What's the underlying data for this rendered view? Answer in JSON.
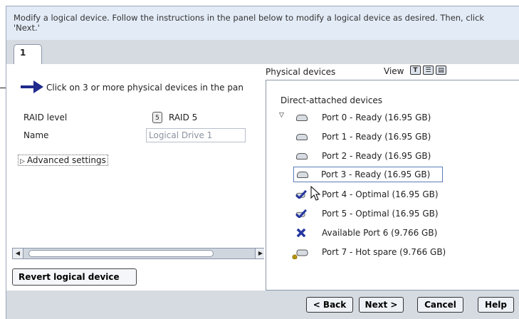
{
  "header": {
    "text": "Modify a logical device.  Follow the instructions in the panel below to modify a logical device as desired. Then, click 'Next.'"
  },
  "tabs": [
    {
      "label": "1"
    }
  ],
  "left": {
    "instruction": "Click on 3 or more physical devices in the pan",
    "raid_label": "RAID level",
    "raid_icon_text": "5",
    "raid_value": "RAID 5",
    "name_label": "Name",
    "name_value": "Logical Drive 1",
    "advanced_label": "Advanced settings",
    "revert_label": "Revert logical device"
  },
  "right": {
    "title": "Physical devices",
    "view_label": "View",
    "view_icons": [
      "T",
      "☰",
      "▤"
    ],
    "tree_title": "Direct-attached devices",
    "devices": [
      {
        "label": "Port 0 - Ready (16.95 GB)",
        "icon": "disk-icon"
      },
      {
        "label": "Port 1 - Ready (16.95 GB)",
        "icon": "disk-icon"
      },
      {
        "label": "Port 2 - Ready (16.95 GB)",
        "icon": "disk-icon"
      },
      {
        "label": "Port 3 - Ready (16.95 GB)",
        "icon": "disk-icon",
        "selected": true
      },
      {
        "label": "Port 4 - Optimal (16.95 GB)",
        "icon": "check-disk-icon"
      },
      {
        "label": "Port 5 - Optimal (16.95 GB)",
        "icon": "check-disk-icon"
      },
      {
        "label": "Available  Port 6 (9.766 GB)",
        "icon": "x-icon"
      },
      {
        "label": "Port 7 - Hot spare (9.766 GB)",
        "icon": "hotspare-disk-icon"
      }
    ]
  },
  "footer": {
    "back": "< Back",
    "next": "Next >",
    "cancel": "Cancel",
    "help": "Help"
  },
  "colors": {
    "header_bg": "#e3ebf6",
    "panel_bg": "#d6dbe2",
    "arrow": "#1f2a8c",
    "check": "#2636a0"
  }
}
